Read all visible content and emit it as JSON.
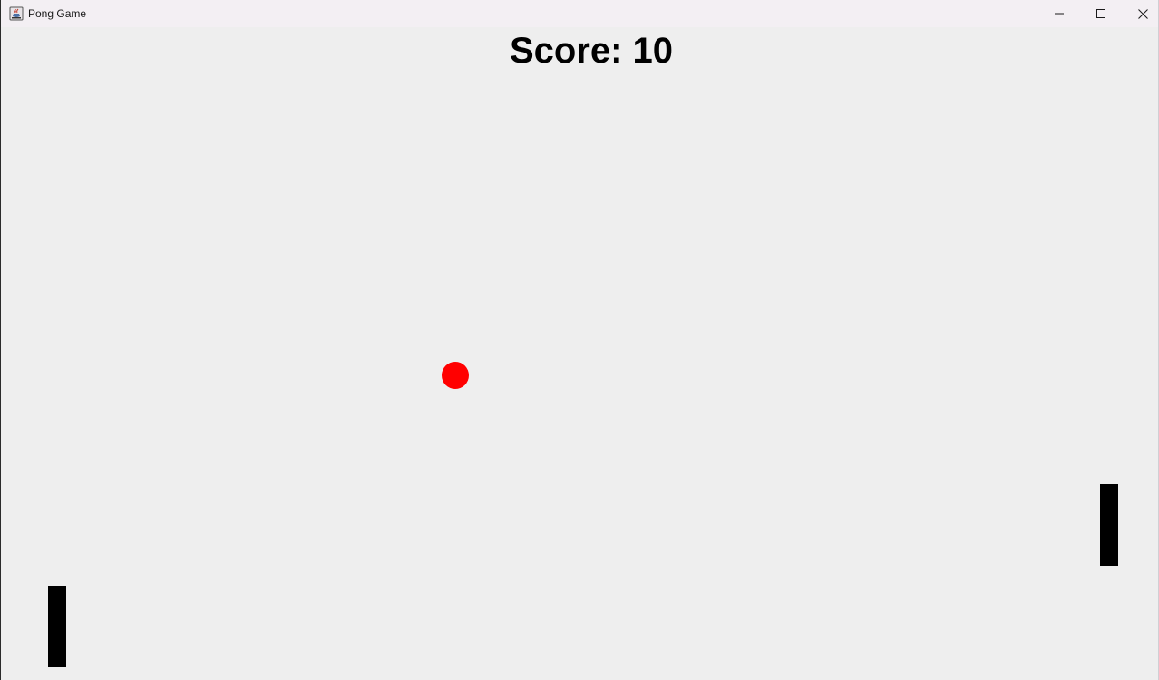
{
  "window": {
    "title": "Pong Game",
    "app_icon": "java-cup-icon",
    "controls": {
      "minimize_icon": "minimize-icon",
      "maximize_icon": "maximize-icon",
      "close_icon": "close-icon"
    }
  },
  "game": {
    "score_label": "Score: 10",
    "colors": {
      "background": "#eeeeee",
      "ball": "#ff0000",
      "paddle": "#000000",
      "score_text": "#000000"
    }
  }
}
